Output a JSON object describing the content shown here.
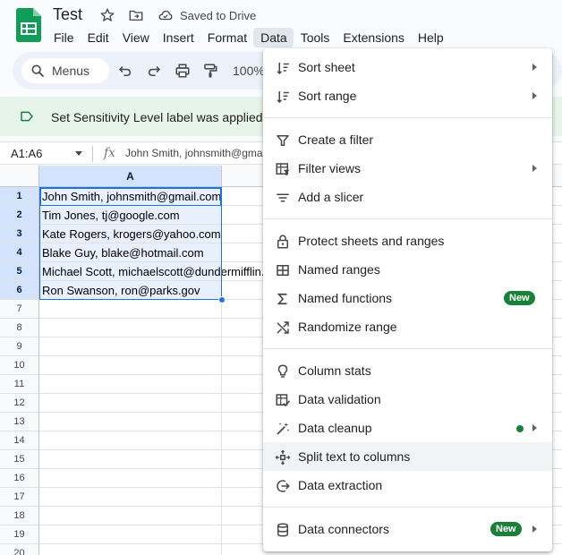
{
  "app": {
    "doc_title": "Test",
    "saved_status": "Saved to Drive"
  },
  "menubar": [
    "File",
    "Edit",
    "View",
    "Insert",
    "Format",
    "Data",
    "Tools",
    "Extensions",
    "Help"
  ],
  "toolbar": {
    "menus_label": "Menus",
    "zoom": "100%"
  },
  "banner": {
    "text": "Set Sensitivity Level label was applied"
  },
  "formula_bar": {
    "name_box": "A1:A6",
    "fx": "fx",
    "formula": "John Smith, johnsmith@gmail.com"
  },
  "grid": {
    "column_a": "A",
    "rows": [
      {
        "n": "1",
        "a": "John Smith, johnsmith@gmail.com"
      },
      {
        "n": "2",
        "a": "Tim Jones, tj@google.com"
      },
      {
        "n": "3",
        "a": "Kate Rogers, krogers@yahoo.com"
      },
      {
        "n": "4",
        "a": "Blake Guy, blake@hotmail.com"
      },
      {
        "n": "5",
        "a": "Michael Scott, michaelscott@dundermifflin.com"
      },
      {
        "n": "6",
        "a": "Ron Swanson, ron@parks.gov"
      },
      {
        "n": "7",
        "a": ""
      },
      {
        "n": "8",
        "a": ""
      },
      {
        "n": "9",
        "a": ""
      },
      {
        "n": "10",
        "a": ""
      },
      {
        "n": "11",
        "a": ""
      },
      {
        "n": "12",
        "a": ""
      },
      {
        "n": "13",
        "a": ""
      },
      {
        "n": "14",
        "a": ""
      },
      {
        "n": "15",
        "a": ""
      },
      {
        "n": "16",
        "a": ""
      },
      {
        "n": "17",
        "a": ""
      },
      {
        "n": "18",
        "a": ""
      },
      {
        "n": "19",
        "a": ""
      },
      {
        "n": "20",
        "a": ""
      }
    ]
  },
  "data_menu": {
    "items": [
      {
        "label": "Sort sheet",
        "icon": "sort-icon"
      },
      {
        "label": "Sort range",
        "icon": "sort-icon"
      },
      {
        "label": "Create a filter",
        "icon": "filter-icon"
      },
      {
        "label": "Filter views",
        "icon": "filter-views-icon"
      },
      {
        "label": "Add a slicer",
        "icon": "slicer-icon"
      },
      {
        "label": "Protect sheets and ranges",
        "icon": "lock-icon"
      },
      {
        "label": "Named ranges",
        "icon": "table-icon"
      },
      {
        "label": "Named functions",
        "icon": "sigma-icon",
        "badge": "New"
      },
      {
        "label": "Randomize range",
        "icon": "shuffle-icon"
      },
      {
        "label": "Column stats",
        "icon": "lightbulb-icon"
      },
      {
        "label": "Data validation",
        "icon": "data-validation-icon"
      },
      {
        "label": "Data cleanup",
        "icon": "magic-wand-icon"
      },
      {
        "label": "Split text to columns",
        "icon": "split-icon"
      },
      {
        "label": "Data extraction",
        "icon": "extract-icon"
      },
      {
        "label": "Data connectors",
        "icon": "database-icon",
        "badge": "New"
      }
    ]
  },
  "colors": {
    "accent": "#1a73e8",
    "new_badge": "#188038",
    "banner_bg": "#e6f4ea",
    "selected_header": "#d3e3fd"
  }
}
